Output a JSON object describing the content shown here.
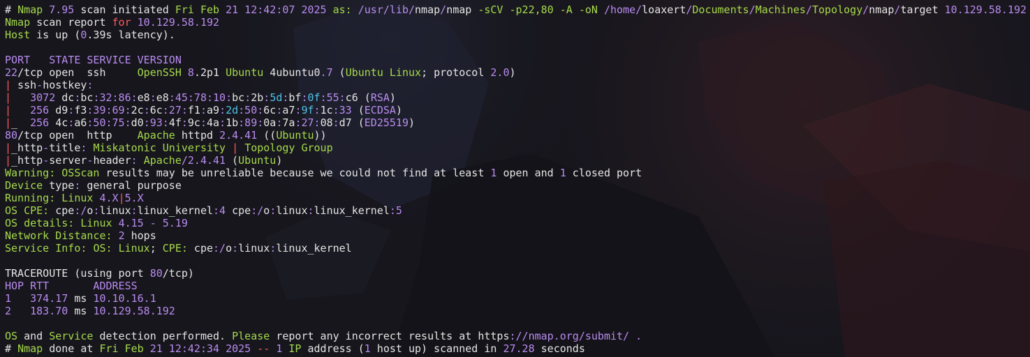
{
  "colors": {
    "background": "#17161d",
    "default": "#e5e5e5",
    "green": "#a6da4a",
    "purple": "#b98cf0",
    "red": "#ff5c5c",
    "cyan": "#4fc3e8",
    "blue": "#7b8cff"
  },
  "lines": [
    [
      [
        "default",
        "# "
      ],
      [
        "green",
        "Nmap"
      ],
      [
        "default",
        " "
      ],
      [
        "purple",
        "7.95"
      ],
      [
        "default",
        " scan initiated "
      ],
      [
        "green",
        "Fri Feb"
      ],
      [
        "default",
        " "
      ],
      [
        "purple",
        "21 12:42:07 2025"
      ],
      [
        "default",
        " "
      ],
      [
        "green",
        "as:"
      ],
      [
        "default",
        " "
      ],
      [
        "purple",
        "/usr/lib/"
      ],
      [
        "default",
        "nmap"
      ],
      [
        "purple",
        "/"
      ],
      [
        "default",
        "nmap "
      ],
      [
        "green",
        "-sCV"
      ],
      [
        "default",
        " "
      ],
      [
        "green",
        "-p22,80"
      ],
      [
        "default",
        " "
      ],
      [
        "green",
        "-A"
      ],
      [
        "default",
        " "
      ],
      [
        "green",
        "-oN"
      ],
      [
        "default",
        " "
      ],
      [
        "purple",
        "/home/"
      ],
      [
        "default",
        "loaxert"
      ],
      [
        "purple",
        "/"
      ],
      [
        "green",
        "Documents"
      ],
      [
        "purple",
        "/"
      ],
      [
        "green",
        "Machines"
      ],
      [
        "purple",
        "/"
      ],
      [
        "green",
        "Topology"
      ],
      [
        "purple",
        "/"
      ],
      [
        "default",
        "nmap"
      ],
      [
        "purple",
        "/"
      ],
      [
        "default",
        "target "
      ],
      [
        "purple",
        "10.129.58.192"
      ]
    ],
    [
      [
        "green",
        "Nmap"
      ],
      [
        "default",
        " scan report "
      ],
      [
        "red",
        "for"
      ],
      [
        "default",
        " "
      ],
      [
        "purple",
        "10.129.58.192"
      ]
    ],
    [
      [
        "green",
        "Host"
      ],
      [
        "default",
        " is up ("
      ],
      [
        "purple",
        "0"
      ],
      [
        "default",
        ".39s latency)."
      ]
    ],
    [],
    [
      [
        "purple",
        "PORT   STATE SERVICE VERSION"
      ]
    ],
    [
      [
        "purple",
        "22"
      ],
      [
        "default",
        "/tcp open  ssh     "
      ],
      [
        "green",
        "OpenSSH"
      ],
      [
        "default",
        " "
      ],
      [
        "purple",
        "8"
      ],
      [
        "default",
        ".2p1 "
      ],
      [
        "green",
        "Ubuntu"
      ],
      [
        "default",
        " 4ubuntu0"
      ],
      [
        "purple",
        ".7"
      ],
      [
        "default",
        " ("
      ],
      [
        "green",
        "Ubuntu Linux"
      ],
      [
        "default",
        "; protocol "
      ],
      [
        "purple",
        "2.0"
      ],
      [
        "default",
        ")"
      ]
    ],
    [
      [
        "red",
        "|"
      ],
      [
        "default",
        " ssh"
      ],
      [
        "purple",
        "-"
      ],
      [
        "default",
        "hostkey"
      ],
      [
        "purple",
        ":"
      ]
    ],
    [
      [
        "red",
        "|"
      ],
      [
        "default",
        "   "
      ],
      [
        "purple",
        "3072"
      ],
      [
        "default",
        " dc"
      ],
      [
        "purple",
        ":"
      ],
      [
        "default",
        "bc"
      ],
      [
        "purple",
        ":32:86:"
      ],
      [
        "default",
        "e8"
      ],
      [
        "purple",
        ":"
      ],
      [
        "default",
        "e8"
      ],
      [
        "purple",
        ":45:78:10:"
      ],
      [
        "default",
        "bc"
      ],
      [
        "purple",
        ":"
      ],
      [
        "default",
        "2b"
      ],
      [
        "purple",
        ":"
      ],
      [
        "cyan",
        "5d"
      ],
      [
        "purple",
        ":"
      ],
      [
        "default",
        "bf"
      ],
      [
        "purple",
        ":"
      ],
      [
        "cyan",
        "0f"
      ],
      [
        "purple",
        ":55:"
      ],
      [
        "default",
        "c6 ("
      ],
      [
        "purple",
        "RSA"
      ],
      [
        "default",
        ")"
      ]
    ],
    [
      [
        "red",
        "|"
      ],
      [
        "default",
        "   "
      ],
      [
        "purple",
        "256"
      ],
      [
        "default",
        " d9"
      ],
      [
        "purple",
        ":"
      ],
      [
        "default",
        "f3"
      ],
      [
        "purple",
        ":39:69:"
      ],
      [
        "default",
        "2c"
      ],
      [
        "purple",
        ":"
      ],
      [
        "default",
        "6c"
      ],
      [
        "purple",
        ":27:"
      ],
      [
        "default",
        "f1"
      ],
      [
        "purple",
        ":"
      ],
      [
        "default",
        "a9"
      ],
      [
        "purple",
        ":"
      ],
      [
        "cyan",
        "2d"
      ],
      [
        "purple",
        ":50:"
      ],
      [
        "default",
        "6c"
      ],
      [
        "purple",
        ":"
      ],
      [
        "default",
        "a7"
      ],
      [
        "purple",
        ":"
      ],
      [
        "cyan",
        "9f"
      ],
      [
        "purple",
        ":"
      ],
      [
        "default",
        "1c"
      ],
      [
        "purple",
        ":33"
      ],
      [
        "default",
        " ("
      ],
      [
        "purple",
        "ECDSA"
      ],
      [
        "default",
        ")"
      ]
    ],
    [
      [
        "red",
        "|"
      ],
      [
        "default",
        "_  "
      ],
      [
        "purple",
        "256"
      ],
      [
        "default",
        " 4c"
      ],
      [
        "purple",
        ":"
      ],
      [
        "default",
        "a6"
      ],
      [
        "purple",
        ":50:75:"
      ],
      [
        "default",
        "d0"
      ],
      [
        "purple",
        ":93:"
      ],
      [
        "default",
        "4f"
      ],
      [
        "purple",
        ":"
      ],
      [
        "default",
        "9c"
      ],
      [
        "purple",
        ":"
      ],
      [
        "default",
        "4a"
      ],
      [
        "purple",
        ":"
      ],
      [
        "default",
        "1b"
      ],
      [
        "purple",
        ":89:"
      ],
      [
        "default",
        "0a"
      ],
      [
        "purple",
        ":"
      ],
      [
        "default",
        "7a"
      ],
      [
        "purple",
        ":27:"
      ],
      [
        "default",
        "08"
      ],
      [
        "purple",
        ":"
      ],
      [
        "default",
        "d7 ("
      ],
      [
        "purple",
        "ED25519"
      ],
      [
        "default",
        ")"
      ]
    ],
    [
      [
        "purple",
        "80"
      ],
      [
        "default",
        "/tcp open  http    "
      ],
      [
        "green",
        "Apache"
      ],
      [
        "default",
        " httpd "
      ],
      [
        "purple",
        "2.4.41"
      ],
      [
        "default",
        " (("
      ],
      [
        "green",
        "Ubuntu"
      ],
      [
        "default",
        "))"
      ]
    ],
    [
      [
        "red",
        "|"
      ],
      [
        "default",
        "_http"
      ],
      [
        "purple",
        "-"
      ],
      [
        "default",
        "title"
      ],
      [
        "purple",
        ":"
      ],
      [
        "default",
        " "
      ],
      [
        "green",
        "Miskatonic University"
      ],
      [
        "default",
        " "
      ],
      [
        "red",
        "|"
      ],
      [
        "default",
        " "
      ],
      [
        "green",
        "Topology Group"
      ]
    ],
    [
      [
        "red",
        "|"
      ],
      [
        "default",
        "_http"
      ],
      [
        "purple",
        "-"
      ],
      [
        "default",
        "server"
      ],
      [
        "purple",
        "-"
      ],
      [
        "default",
        "header"
      ],
      [
        "purple",
        ":"
      ],
      [
        "default",
        " "
      ],
      [
        "green",
        "Apache"
      ],
      [
        "purple",
        "/2.4.41"
      ],
      [
        "default",
        " ("
      ],
      [
        "green",
        "Ubuntu"
      ],
      [
        "default",
        ")"
      ]
    ],
    [
      [
        "green",
        "Warning:"
      ],
      [
        "default",
        " "
      ],
      [
        "green",
        "OSScan"
      ],
      [
        "default",
        " results may be unreliable because we could not find at least "
      ],
      [
        "purple",
        "1"
      ],
      [
        "default",
        " open and "
      ],
      [
        "purple",
        "1"
      ],
      [
        "default",
        " closed port"
      ]
    ],
    [
      [
        "green",
        "Device"
      ],
      [
        "default",
        " type"
      ],
      [
        "purple",
        ":"
      ],
      [
        "default",
        " general purpose"
      ]
    ],
    [
      [
        "green",
        "Running:"
      ],
      [
        "default",
        " "
      ],
      [
        "green",
        "Linux"
      ],
      [
        "default",
        " "
      ],
      [
        "purple",
        "4.X"
      ],
      [
        "red",
        "|"
      ],
      [
        "purple",
        "5.X"
      ]
    ],
    [
      [
        "green",
        "OS CPE:"
      ],
      [
        "default",
        " cpe"
      ],
      [
        "purple",
        ":/"
      ],
      [
        "default",
        "o"
      ],
      [
        "purple",
        ":"
      ],
      [
        "default",
        "linux"
      ],
      [
        "purple",
        ":"
      ],
      [
        "default",
        "linux_kernel"
      ],
      [
        "purple",
        ":4"
      ],
      [
        "default",
        " cpe"
      ],
      [
        "purple",
        ":/"
      ],
      [
        "default",
        "o"
      ],
      [
        "purple",
        ":"
      ],
      [
        "default",
        "linux"
      ],
      [
        "purple",
        ":"
      ],
      [
        "default",
        "linux_kernel"
      ],
      [
        "purple",
        ":5"
      ]
    ],
    [
      [
        "green",
        "OS"
      ],
      [
        "default",
        " "
      ],
      [
        "green",
        "details:"
      ],
      [
        "default",
        " "
      ],
      [
        "green",
        "Linux"
      ],
      [
        "default",
        " "
      ],
      [
        "purple",
        "4.15 - 5.19"
      ]
    ],
    [
      [
        "green",
        "Network Distance:"
      ],
      [
        "default",
        " "
      ],
      [
        "purple",
        "2"
      ],
      [
        "default",
        " hops"
      ]
    ],
    [
      [
        "green",
        "Service Info:"
      ],
      [
        "default",
        " "
      ],
      [
        "green",
        "OS:"
      ],
      [
        "default",
        " "
      ],
      [
        "green",
        "Linux"
      ],
      [
        "default",
        "; "
      ],
      [
        "green",
        "CPE:"
      ],
      [
        "default",
        " cpe"
      ],
      [
        "purple",
        ":/"
      ],
      [
        "default",
        "o"
      ],
      [
        "purple",
        ":"
      ],
      [
        "default",
        "linux"
      ],
      [
        "purple",
        ":"
      ],
      [
        "default",
        "linux_kernel"
      ]
    ],
    [],
    [
      [
        "default",
        "TRACEROUTE (using port "
      ],
      [
        "purple",
        "80"
      ],
      [
        "default",
        "/tcp)"
      ]
    ],
    [
      [
        "purple",
        "HOP RTT       ADDRESS"
      ]
    ],
    [
      [
        "purple",
        "1"
      ],
      [
        "default",
        "   "
      ],
      [
        "purple",
        "374.17"
      ],
      [
        "default",
        " ms "
      ],
      [
        "purple",
        "10.10.16.1"
      ]
    ],
    [
      [
        "purple",
        "2"
      ],
      [
        "default",
        "   "
      ],
      [
        "purple",
        "183.70"
      ],
      [
        "default",
        " ms "
      ],
      [
        "purple",
        "10.129.58.192"
      ]
    ],
    [],
    [
      [
        "green",
        "OS"
      ],
      [
        "default",
        " and "
      ],
      [
        "green",
        "Service"
      ],
      [
        "default",
        " detection performed. "
      ],
      [
        "green",
        "Please"
      ],
      [
        "default",
        " report any incorrect results at https"
      ],
      [
        "purple",
        "://nmap.org/submit/ ."
      ]
    ],
    [
      [
        "default",
        "# "
      ],
      [
        "green",
        "Nmap"
      ],
      [
        "default",
        " done at "
      ],
      [
        "green",
        "Fri Feb"
      ],
      [
        "default",
        " "
      ],
      [
        "purple",
        "21 12:42:34 2025"
      ],
      [
        "default",
        " "
      ],
      [
        "red",
        "--"
      ],
      [
        "default",
        " "
      ],
      [
        "purple",
        "1"
      ],
      [
        "default",
        " "
      ],
      [
        "green",
        "IP"
      ],
      [
        "default",
        " address ("
      ],
      [
        "purple",
        "1"
      ],
      [
        "default",
        " host up) scanned in "
      ],
      [
        "purple",
        "27.28"
      ],
      [
        "default",
        " seconds"
      ]
    ]
  ]
}
